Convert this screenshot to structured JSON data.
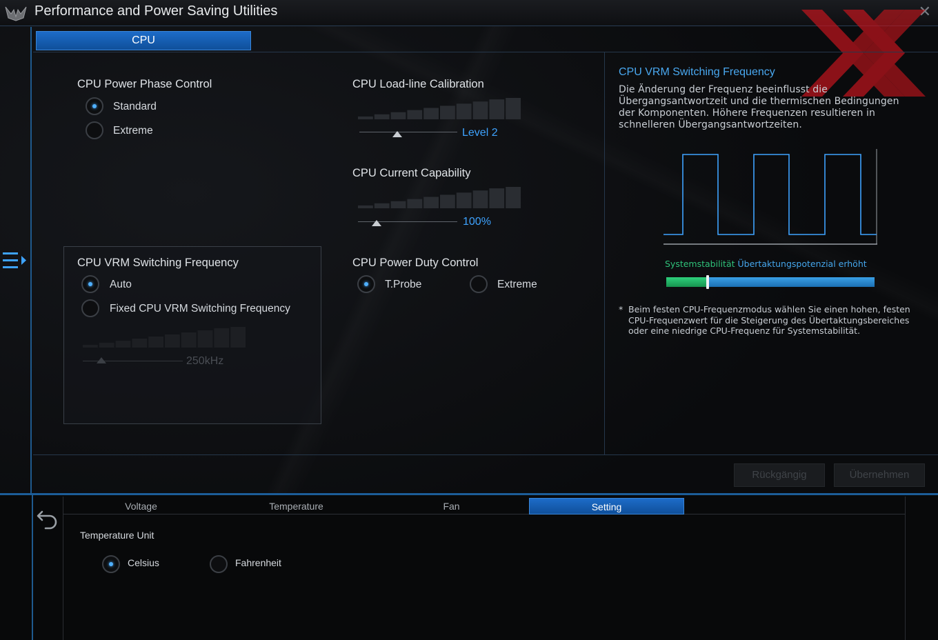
{
  "window": {
    "title": "Performance and Power Saving Utilities",
    "close_glyph": "✕"
  },
  "top_tab": {
    "label": "CPU"
  },
  "power_phase": {
    "title": "CPU Power Phase Control",
    "options": [
      "Standard",
      "Extreme"
    ],
    "selected": "Standard"
  },
  "vrm_freq": {
    "title": "CPU VRM Switching Frequency",
    "options": [
      "Auto",
      "Fixed CPU VRM Switching Frequency"
    ],
    "selected": "Auto",
    "slider_value": "250kHz",
    "slider_level": 0.0
  },
  "llc": {
    "title": "CPU Load-line Calibration",
    "value": "Level 2",
    "level": 0.2
  },
  "current_cap": {
    "title": "CPU Current Capability",
    "value": "100%",
    "level": 0.0
  },
  "duty": {
    "title": "CPU Power Duty Control",
    "options": [
      "T.Probe",
      "Extreme"
    ],
    "selected": "T.Probe"
  },
  "info": {
    "title": "CPU VRM Switching Frequency",
    "text": "Die Änderung der Frequenz beeinflusst die Übergangsantwortzeit und die thermischen Bedingungen der Komponenten. Höhere Frequenzen resultieren in schnelleren Übergangsantwortzeiten.",
    "stability_label": "Systemstabilität",
    "oc_label": "Übertaktungspotenzial erhöht",
    "stability_level": 0.2,
    "note_star": "*",
    "note": "Beim festen CPU-Frequenzmodus wählen Sie einen hohen, festen CPU-Frequenzwert für die Steigerung des Übertaktungsbereiches oder eine niedrige CPU-Frequenz für Systemstabilität."
  },
  "buttons": {
    "undo": "Rückgängig",
    "apply": "Übernehmen"
  },
  "bottom_tabs": [
    {
      "label": "Voltage"
    },
    {
      "label": "Temperature"
    },
    {
      "label": "Fan"
    },
    {
      "label": "Setting"
    }
  ],
  "active_bottom_tab": "Setting",
  "temp_unit": {
    "title": "Temperature Unit",
    "options": [
      "Celsius",
      "Fahrenheit"
    ],
    "selected": "Celsius"
  },
  "colors": {
    "accent": "#1d6cc8",
    "value_blue": "#3ea3ff",
    "stability_green": "#2fc27a",
    "watermark_red": "#c8161e"
  }
}
